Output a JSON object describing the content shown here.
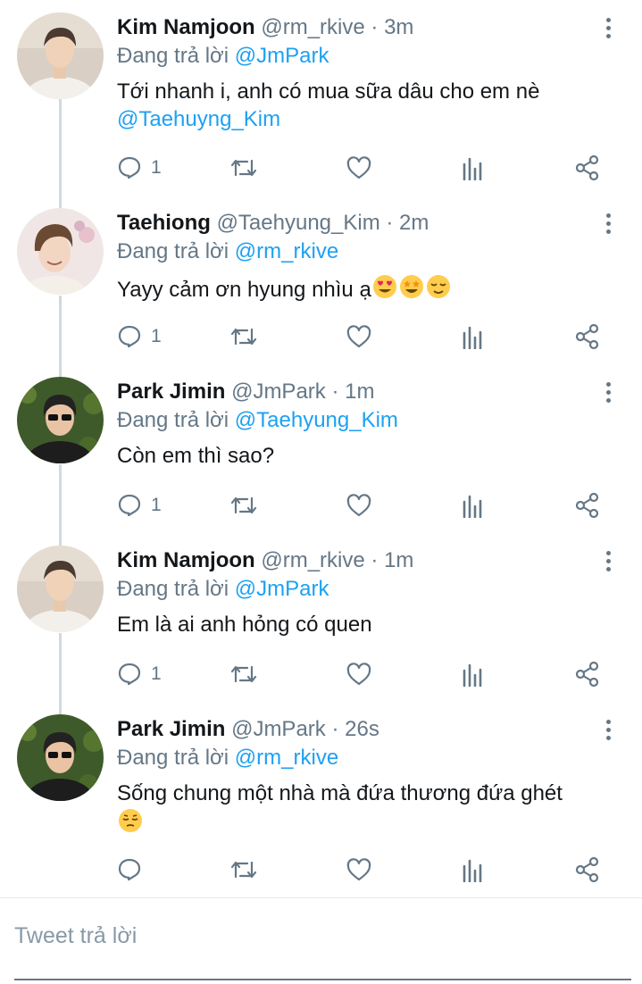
{
  "tweets": [
    {
      "name": "Kim Namjoon",
      "handle": "@rm_rkive",
      "separator": "·",
      "time": "3m",
      "replying_prefix": "Đang trả lời",
      "replying_to": "@JmPark",
      "text": "Tới nhanh i, anh có mua sữa dâu cho em nè",
      "text_mention": "@Taehuyng_Kim",
      "emojis": [],
      "reply_count": "1"
    },
    {
      "name": "Taehiong",
      "handle": "@Taehyung_Kim",
      "separator": "·",
      "time": "2m",
      "replying_prefix": "Đang trả lời",
      "replying_to": "@rm_rkive",
      "text": "Yayy cảm ơn hyung nhìu ạ",
      "text_mention": "",
      "emojis": [
        "heart-eyes-emoji",
        "star-struck-emoji",
        "relieved-emoji"
      ],
      "reply_count": "1"
    },
    {
      "name": "Park Jimin",
      "handle": "@JmPark",
      "separator": "·",
      "time": "1m",
      "replying_prefix": "Đang trả lời",
      "replying_to": "@Taehyung_Kim",
      "text": "Còn em thì sao?",
      "text_mention": "",
      "emojis": [],
      "reply_count": "1"
    },
    {
      "name": "Kim Namjoon",
      "handle": "@rm_rkive",
      "separator": "·",
      "time": "1m",
      "replying_prefix": "Đang trả lời",
      "replying_to": "@JmPark",
      "text": "Em là ai anh hỏng có quen",
      "text_mention": "",
      "emojis": [],
      "reply_count": "1"
    },
    {
      "name": "Park Jimin",
      "handle": "@JmPark",
      "separator": "·",
      "time": "26s",
      "replying_prefix": "Đang trả lời",
      "replying_to": "@rm_rkive",
      "text": "Sống chung một nhà mà đứa thương đứa ghét",
      "text_mention": "",
      "emojis": [
        "pensive-emoji"
      ],
      "reply_count": ""
    }
  ],
  "composer": {
    "placeholder": "Tweet trả lời"
  },
  "colors": {
    "link": "#1da1f2",
    "secondary_text": "#657786",
    "thread_line": "#cfd9de"
  }
}
